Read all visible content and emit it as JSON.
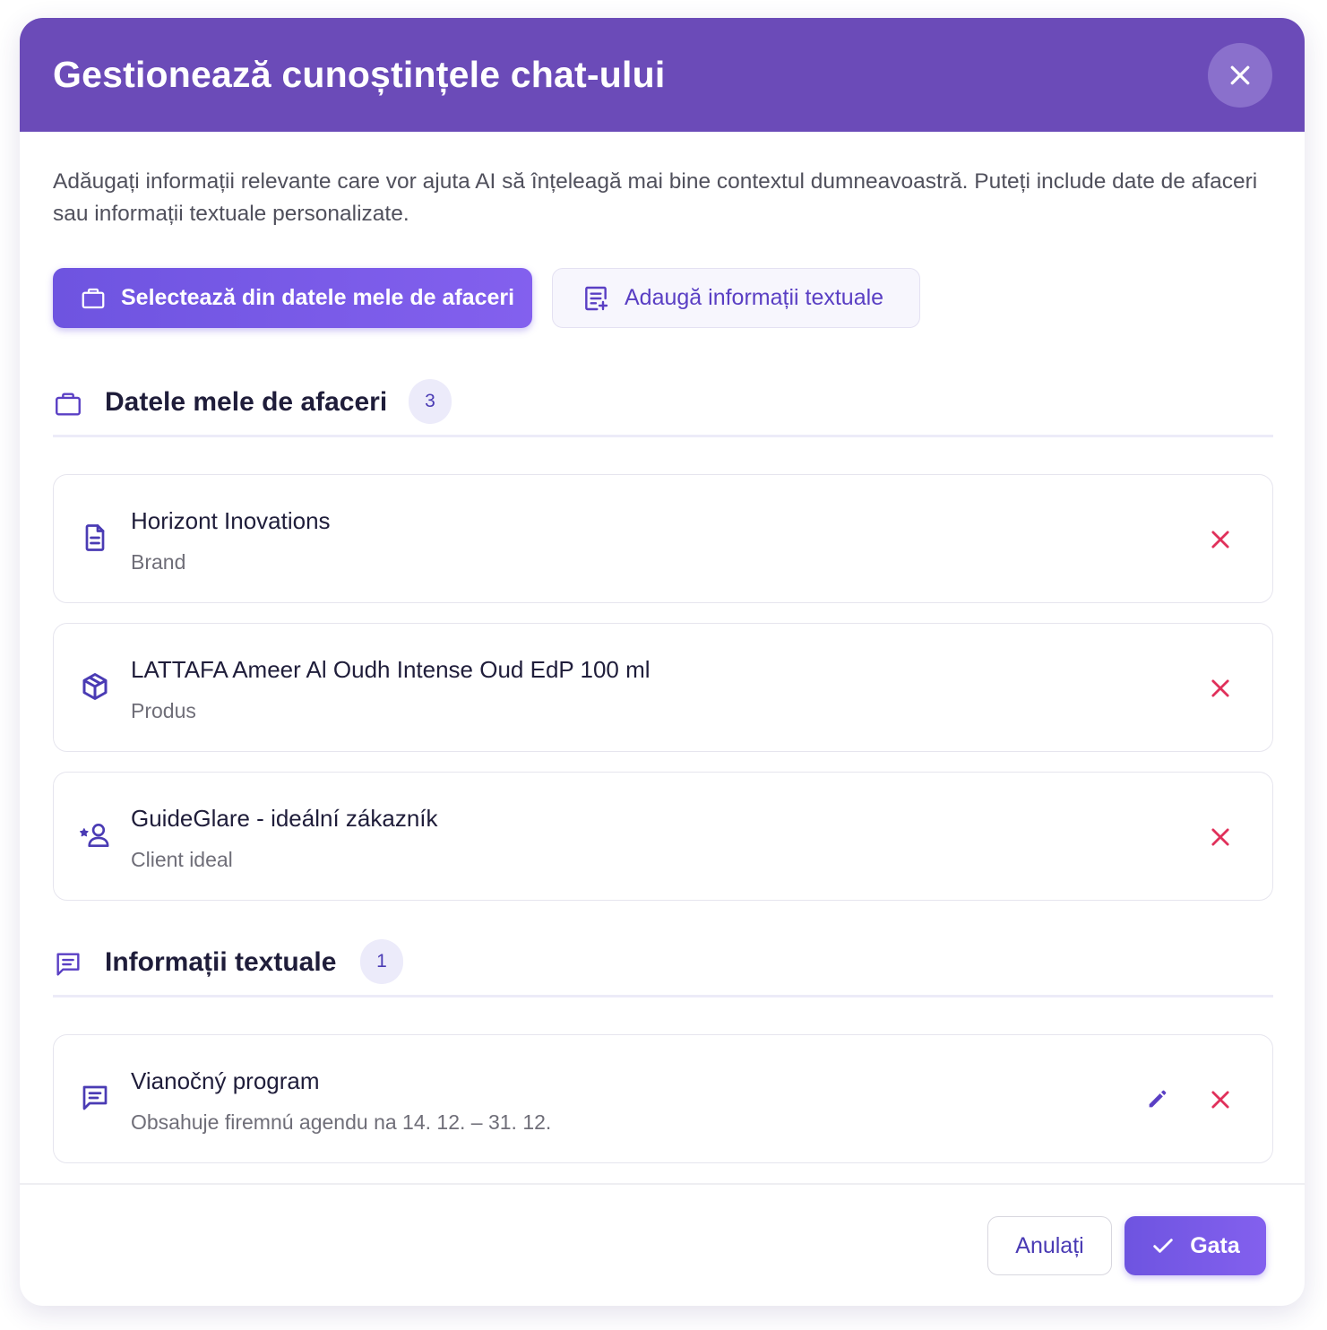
{
  "dialog": {
    "title": "Gestionează cunoștințele chat-ului",
    "close_icon": "close-icon",
    "intro_text": "Adăugați informații relevante care vor ajuta AI să înțeleagă mai bine contextul dumneavoastră. Puteți include date de afaceri sau informații textuale personalizate."
  },
  "actions": {
    "select_business_label": "Selectează din datele mele de afaceri",
    "select_business_icon": "briefcase-icon",
    "add_text_label": "Adaugă informații textuale",
    "add_text_icon": "note-add-icon"
  },
  "business_section": {
    "title": "Datele mele de afaceri",
    "count": "3",
    "icon": "briefcase-icon",
    "items": [
      {
        "title": "Horizont Inovations",
        "subtitle": "Brand",
        "icon": "document-icon"
      },
      {
        "title": "LATTAFA Ameer Al Oudh Intense Oud EdP 100 ml",
        "subtitle": "Produs",
        "icon": "package-icon"
      },
      {
        "title": "GuideGlare - ideální zákazník",
        "subtitle": "Client ideal",
        "icon": "user-star-icon"
      }
    ]
  },
  "text_section": {
    "title": "Informații textuale",
    "count": "1",
    "icon": "message-icon",
    "items": [
      {
        "title": "Vianočný program",
        "subtitle": "Obsahuje firemnú agendu na 14. 12. – 31. 12.",
        "icon": "message-icon"
      }
    ]
  },
  "footer": {
    "cancel_label": "Anulați",
    "done_label": "Gata",
    "done_icon": "check-icon"
  },
  "colors": {
    "header": "#6b4bb8",
    "primary": "#6e54e0",
    "accent_text": "#4a3bb4",
    "remove": "#e0305a"
  }
}
